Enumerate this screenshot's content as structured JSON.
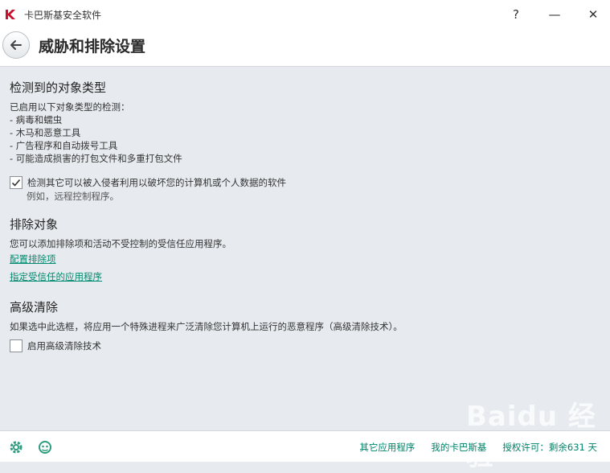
{
  "window": {
    "title": "卡巴斯基安全软件",
    "help": "?",
    "minimize": "—",
    "close": "✕"
  },
  "header": {
    "title": "威胁和排除设置"
  },
  "detected": {
    "title": "检测到的对象类型",
    "intro": "已启用以下对象类型的检测：",
    "items": [
      "- 病毒和蠕虫",
      "- 木马和恶意工具",
      "- 广告程序和自动拨号工具",
      "- 可能造成损害的打包文件和多重打包文件"
    ],
    "checkbox_label": "检测其它可以被入侵者利用以破坏您的计算机或个人数据的软件",
    "checkbox_checked": true,
    "example": "例如，远程控制程序。"
  },
  "exclusions": {
    "title": "排除对象",
    "description": "您可以添加排除项和活动不受控制的受信任应用程序。",
    "link1": "配置排除项",
    "link2": "指定受信任的应用程序"
  },
  "advanced": {
    "title": "高级清除",
    "description": "如果选中此选框，将应用一个特殊进程来广泛清除您计算机上运行的恶意程序（高级清除技术）。",
    "checkbox_label": "启用高级清除技术",
    "checkbox_checked": false
  },
  "footer": {
    "links": [
      "其它应用程序",
      "我的卡巴斯基",
      "授权许可：剩余631 天"
    ],
    "icons": [
      "gear-icon",
      "support-icon"
    ]
  },
  "watermark": "Baidu 经验"
}
